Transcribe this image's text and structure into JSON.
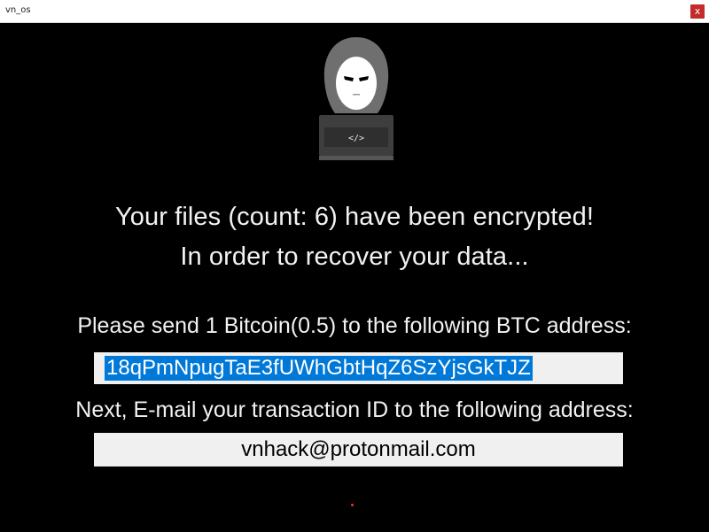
{
  "window": {
    "title": "vn_os",
    "close_glyph": "x"
  },
  "main": {
    "headline_line1": "Your files (count: 6) have been encrypted!",
    "headline_line2": "In order to recover your data...",
    "payment_instruction": "Please send 1 Bitcoin(0.5) to the following BTC address:",
    "btc_address": "18qPmNpugTaE3fUWhGbtHqZ6SzYjsGkTJZ",
    "email_instruction": "Next, E-mail your transaction ID to the following address:",
    "email_address": "vnhack@protonmail.com"
  },
  "icons": {
    "hacker_icon": "hooded-hacker-laptop-icon",
    "laptop_code": "</>"
  },
  "colors": {
    "background": "#000000",
    "text": "#f2f2f2",
    "selection": "#0078d7",
    "close_button": "#c42b2b",
    "accent_dot": "#ff2a2a"
  }
}
